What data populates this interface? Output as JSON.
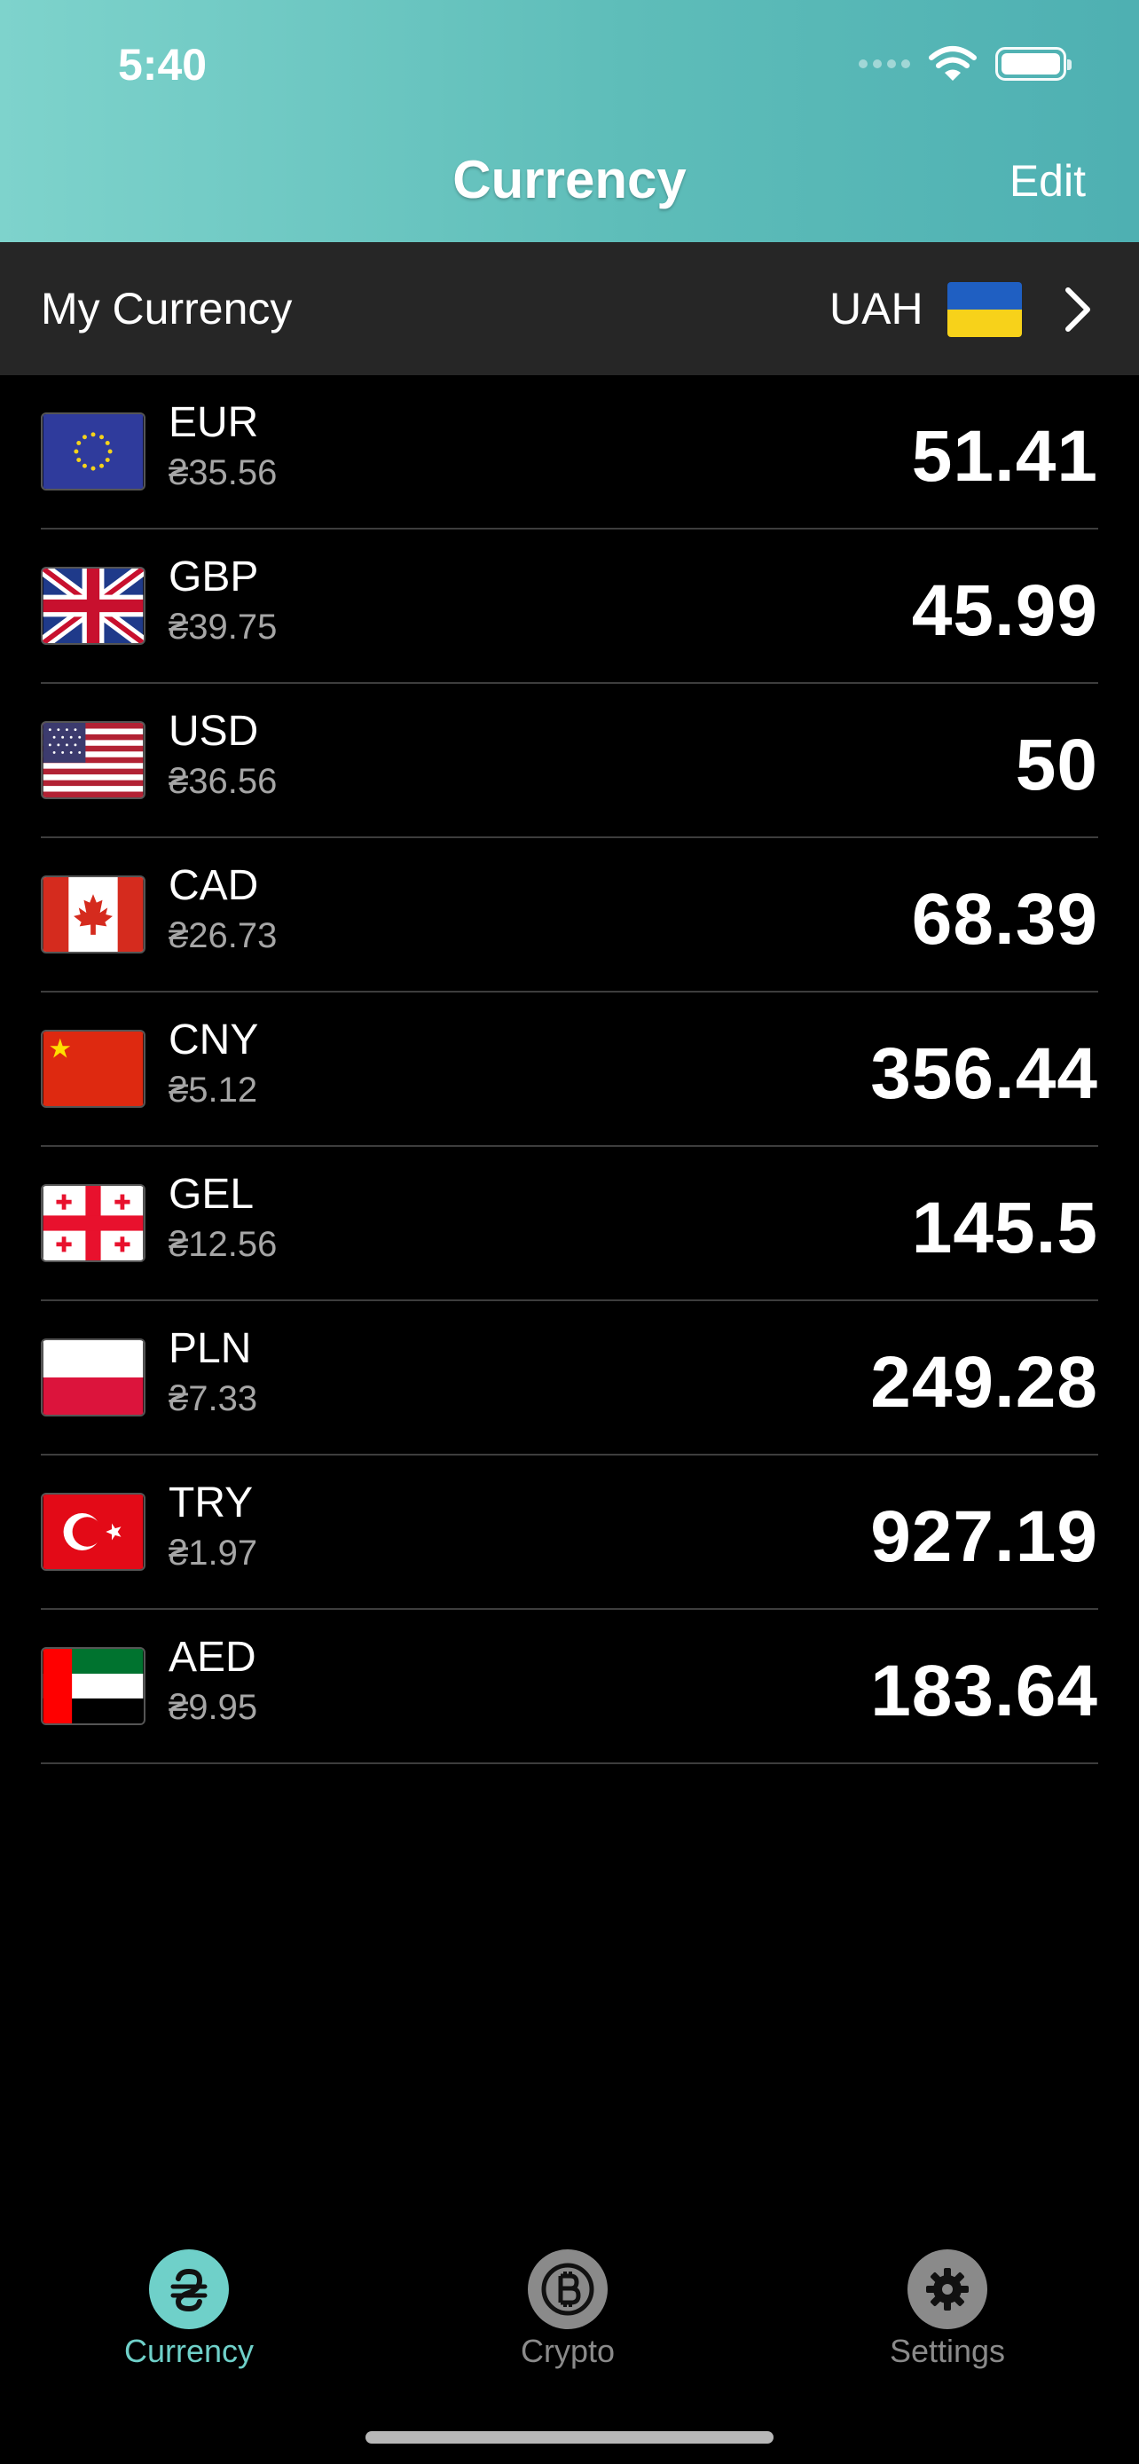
{
  "status_bar": {
    "time": "5:40"
  },
  "nav": {
    "title": "Currency",
    "edit_label": "Edit"
  },
  "my_currency": {
    "label": "My Currency",
    "code": "UAH",
    "flag_icon": "ukraine-flag-icon"
  },
  "currencies": [
    {
      "code": "EUR",
      "rate": "₴35.56",
      "value": "51.41",
      "flag": "eu"
    },
    {
      "code": "GBP",
      "rate": "₴39.75",
      "value": "45.99",
      "flag": "gb"
    },
    {
      "code": "USD",
      "rate": "₴36.56",
      "value": "50",
      "flag": "us"
    },
    {
      "code": "CAD",
      "rate": "₴26.73",
      "value": "68.39",
      "flag": "ca"
    },
    {
      "code": "CNY",
      "rate": "₴5.12",
      "value": "356.44",
      "flag": "cn"
    },
    {
      "code": "GEL",
      "rate": "₴12.56",
      "value": "145.5",
      "flag": "ge"
    },
    {
      "code": "PLN",
      "rate": "₴7.33",
      "value": "249.28",
      "flag": "pl"
    },
    {
      "code": "TRY",
      "rate": "₴1.97",
      "value": "927.19",
      "flag": "tr"
    },
    {
      "code": "AED",
      "rate": "₴9.95",
      "value": "183.64",
      "flag": "ae"
    }
  ],
  "tabs": [
    {
      "label": "Currency",
      "icon": "hryvnia-icon",
      "active": true
    },
    {
      "label": "Crypto",
      "icon": "bitcoin-icon",
      "active": false
    },
    {
      "label": "Settings",
      "icon": "gear-icon",
      "active": false
    }
  ],
  "colors": {
    "accent": "#5ebdb9",
    "active_tab": "#6fd0c9",
    "inactive_tab": "#8a8a8a"
  }
}
